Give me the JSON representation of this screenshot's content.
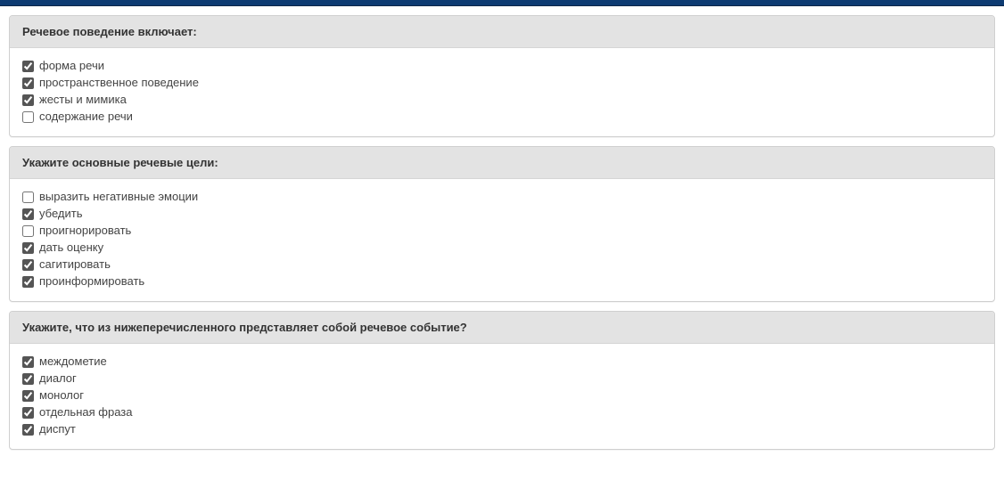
{
  "questions": [
    {
      "title": "Речевое поведение включает:",
      "options": [
        {
          "label": "форма речи",
          "checked": true
        },
        {
          "label": "пространственное поведение",
          "checked": true
        },
        {
          "label": "жесты и мимика",
          "checked": true
        },
        {
          "label": "содержание речи",
          "checked": false
        }
      ]
    },
    {
      "title": "Укажите основные речевые цели:",
      "options": [
        {
          "label": "выразить негативные эмоции",
          "checked": false
        },
        {
          "label": "убедить",
          "checked": true
        },
        {
          "label": "проигнорировать",
          "checked": false
        },
        {
          "label": "дать оценку",
          "checked": true
        },
        {
          "label": "сагитировать",
          "checked": true
        },
        {
          "label": "проинформировать",
          "checked": true
        }
      ]
    },
    {
      "title": "Укажите, что из нижеперечисленного представляет собой речевое событие?",
      "options": [
        {
          "label": "междометие",
          "checked": true
        },
        {
          "label": "диалог",
          "checked": true
        },
        {
          "label": "монолог",
          "checked": true
        },
        {
          "label": "отдельная фраза",
          "checked": true
        },
        {
          "label": "диспут",
          "checked": true
        }
      ]
    }
  ]
}
